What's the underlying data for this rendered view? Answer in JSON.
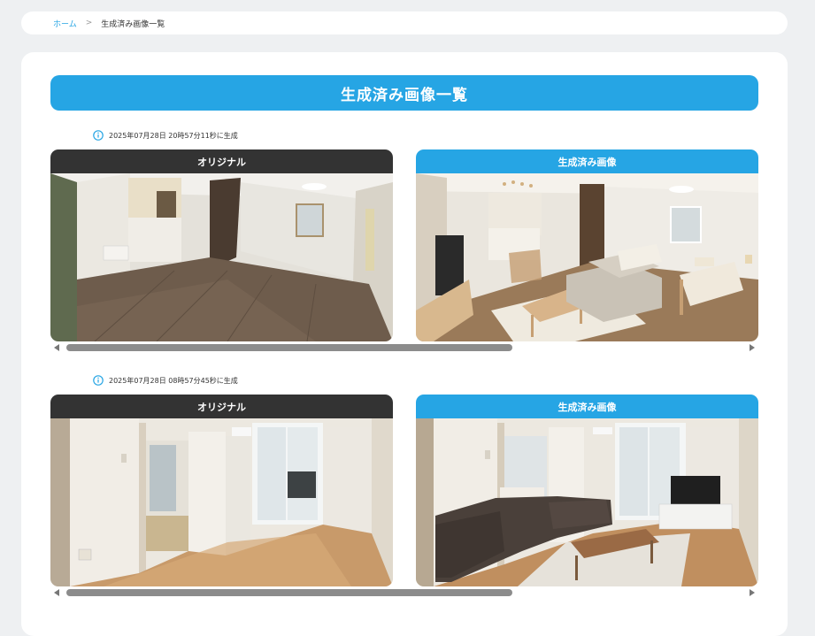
{
  "breadcrumb": {
    "home": "ホーム",
    "separator": ">",
    "current": "生成済み画像一覧"
  },
  "page": {
    "title": "生成済み画像一覧"
  },
  "entries": [
    {
      "timestamp": "2025年07月28日 20時57分11秒に生成",
      "original_label": "オリジナル",
      "generated_label": "生成済み画像"
    },
    {
      "timestamp": "2025年07月28日 08時57分45秒に生成",
      "original_label": "オリジナル",
      "generated_label": "生成済み画像"
    }
  ],
  "colors": {
    "accent": "#26a5e4",
    "dark_header": "#333333",
    "background": "#eef0f2"
  },
  "icons": {
    "info": "info-circle-icon",
    "scroll_left": "triangle-left-icon",
    "scroll_right": "triangle-right-icon"
  }
}
